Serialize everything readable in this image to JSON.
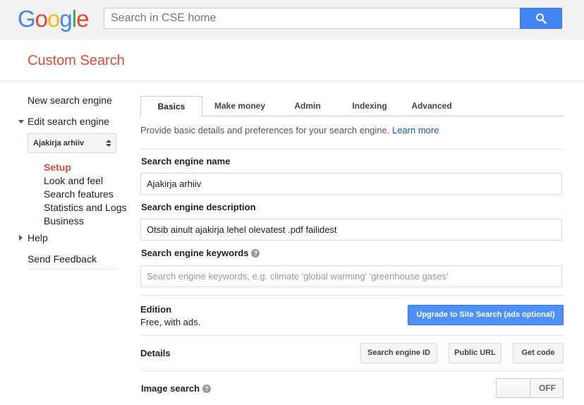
{
  "header": {
    "logo": {
      "letters": [
        "G",
        "o",
        "o",
        "g",
        "l",
        "e"
      ],
      "colors": [
        "#4285f4",
        "#ea4335",
        "#fbbc05",
        "#4285f4",
        "#34a853",
        "#ea4335"
      ]
    },
    "search": {
      "placeholder": "Search in CSE home",
      "value": ""
    },
    "search_button_icon": "magnifier-icon"
  },
  "app": {
    "title": "Custom Search",
    "accent": "#dd4b39"
  },
  "sidebar": {
    "new_engine": "New search engine",
    "edit_engine": "Edit search engine",
    "engine_select": "Ajakirja arhiiv",
    "sub_items": [
      "Setup",
      "Look and feel",
      "Search features",
      "Statistics and Logs",
      "Business"
    ],
    "help": "Help",
    "feedback": "Send Feedback"
  },
  "tabs": [
    "Basics",
    "Make money",
    "Admin",
    "Indexing",
    "Advanced"
  ],
  "intro": {
    "text": "Provide basic details and preferences for your search engine. ",
    "link": "Learn more"
  },
  "form": {
    "name_label": "Search engine name",
    "name_value": "Ajakirja arhiiv",
    "desc_label": "Search engine description",
    "desc_value": "Otsib ainult ajakirja lehel olevatest .pdf failidest",
    "keywords_label": "Search engine keywords",
    "keywords_placeholder": "Search engine keywords, e.g. climate 'global warming' 'greenhouse gases'"
  },
  "edition": {
    "title": "Edition",
    "value": "Free, with ads.",
    "upgrade_button": "Upgrade to Site Search (ads optional)"
  },
  "details": {
    "title": "Details",
    "buttons": [
      "Search engine ID",
      "Public URL",
      "Get code"
    ]
  },
  "image_search": {
    "title": "Image search",
    "toggle": "OFF"
  }
}
